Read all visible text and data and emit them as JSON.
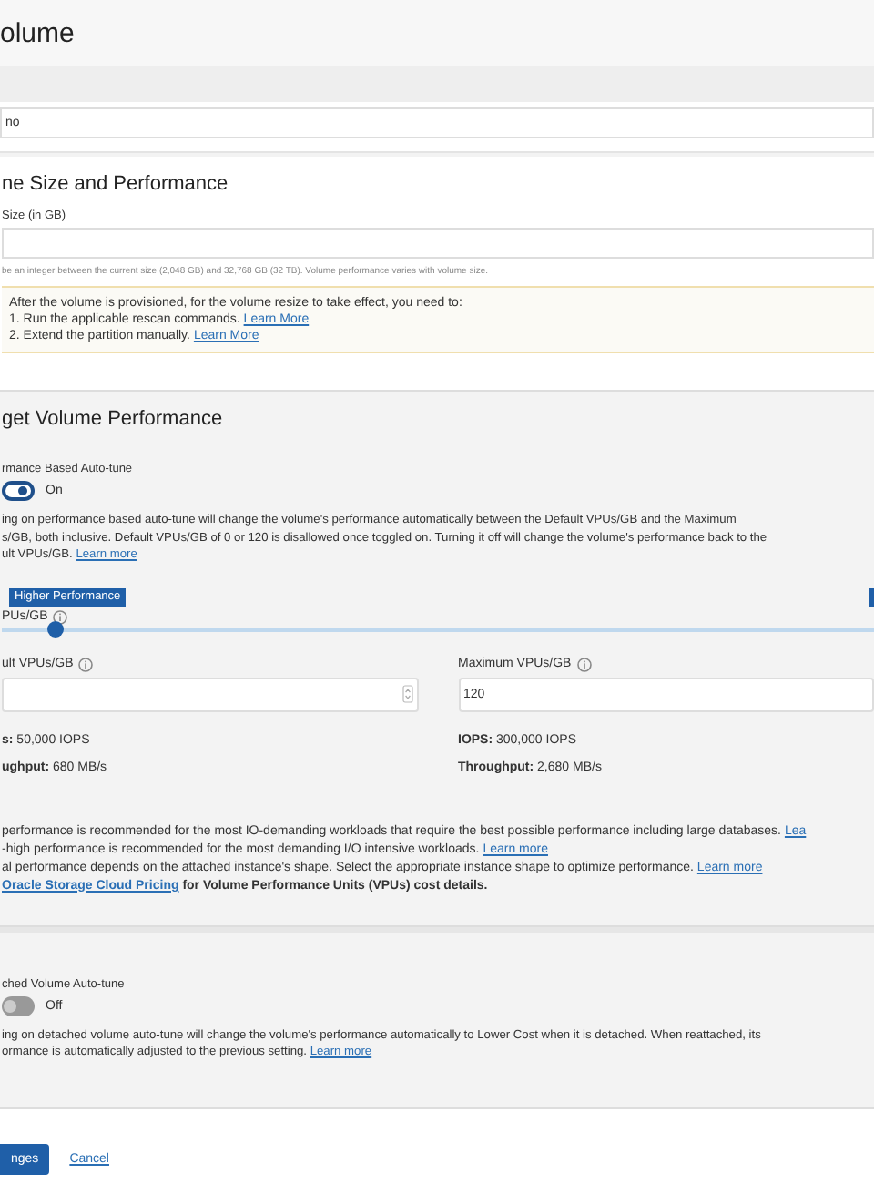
{
  "title": "olume",
  "name_field": {
    "value": "no"
  },
  "size_section": {
    "heading": "ne Size and Performance",
    "label": "Size (in GB)",
    "hint": "be an integer between the current size (2,048 GB) and 32,768 GB (32 TB). Volume performance varies with volume size."
  },
  "notice": {
    "intro": "After the volume is provisioned, for the volume resize to take effect, you need to:",
    "steps": [
      {
        "text": "1. Run the applicable rescan commands.",
        "link": "Learn More"
      },
      {
        "text": "2. Extend the partition manually.",
        "link": "Learn More"
      }
    ]
  },
  "performance": {
    "heading": "get Volume Performance",
    "auto_tune": {
      "label": "rmance Based Auto-tune",
      "on": true,
      "state": "On",
      "lines": [
        "ing on performance based auto-tune will change the volume's performance automatically between the Default VPUs/GB and the Maximum",
        "s/GB, both inclusive. Default VPUs/GB of 0 or 120 is disallowed once toggled on. Turning it off will change the volume's performance back to the",
        "ult VPUs/GB."
      ],
      "link": "Learn more"
    },
    "slider": {
      "tooltip": "Higher Performance",
      "label": "PUs/GB",
      "level": 0.06
    },
    "fields": [
      {
        "label": "ult VPUs/GB",
        "kind": "spinner",
        "stats": [
          {
            "key": "s:",
            "value": "50,000 IOPS"
          },
          {
            "key": "ughput:",
            "value": "680 MB/s"
          }
        ]
      },
      {
        "label": "Maximum VPUs/GB",
        "value": "120",
        "kind": "text",
        "stats": [
          {
            "key": "IOPS:",
            "value": "300,000 IOPS"
          },
          {
            "key": "Throughput:",
            "value": "2,680 MB/s"
          }
        ]
      }
    ],
    "notes": [
      {
        "text": "performance is recommended for the most IO-demanding workloads that require the best possible performance including large databases.",
        "link": "Lea"
      },
      {
        "text": "-high performance is recommended for the most demanding I/O intensive workloads.",
        "link": "Learn more"
      },
      {
        "text": "al performance depends on the attached instance's shape. Select the appropriate instance shape to optimize performance.",
        "link": "Learn more"
      }
    ],
    "pricing": {
      "link": "Oracle Storage Cloud Pricing",
      "text": "for Volume Performance Units (VPUs) cost details."
    }
  },
  "detached": {
    "label": "ched Volume Auto-tune",
    "on": false,
    "state": "Off",
    "lines": [
      "ing on detached volume auto-tune will change the volume's performance automatically to Lower Cost when it is detached. When reattached, its",
      "ormance is automatically adjusted to the previous setting."
    ],
    "link": "Learn more"
  },
  "footer": {
    "save": "nges",
    "cancel": "Cancel"
  }
}
